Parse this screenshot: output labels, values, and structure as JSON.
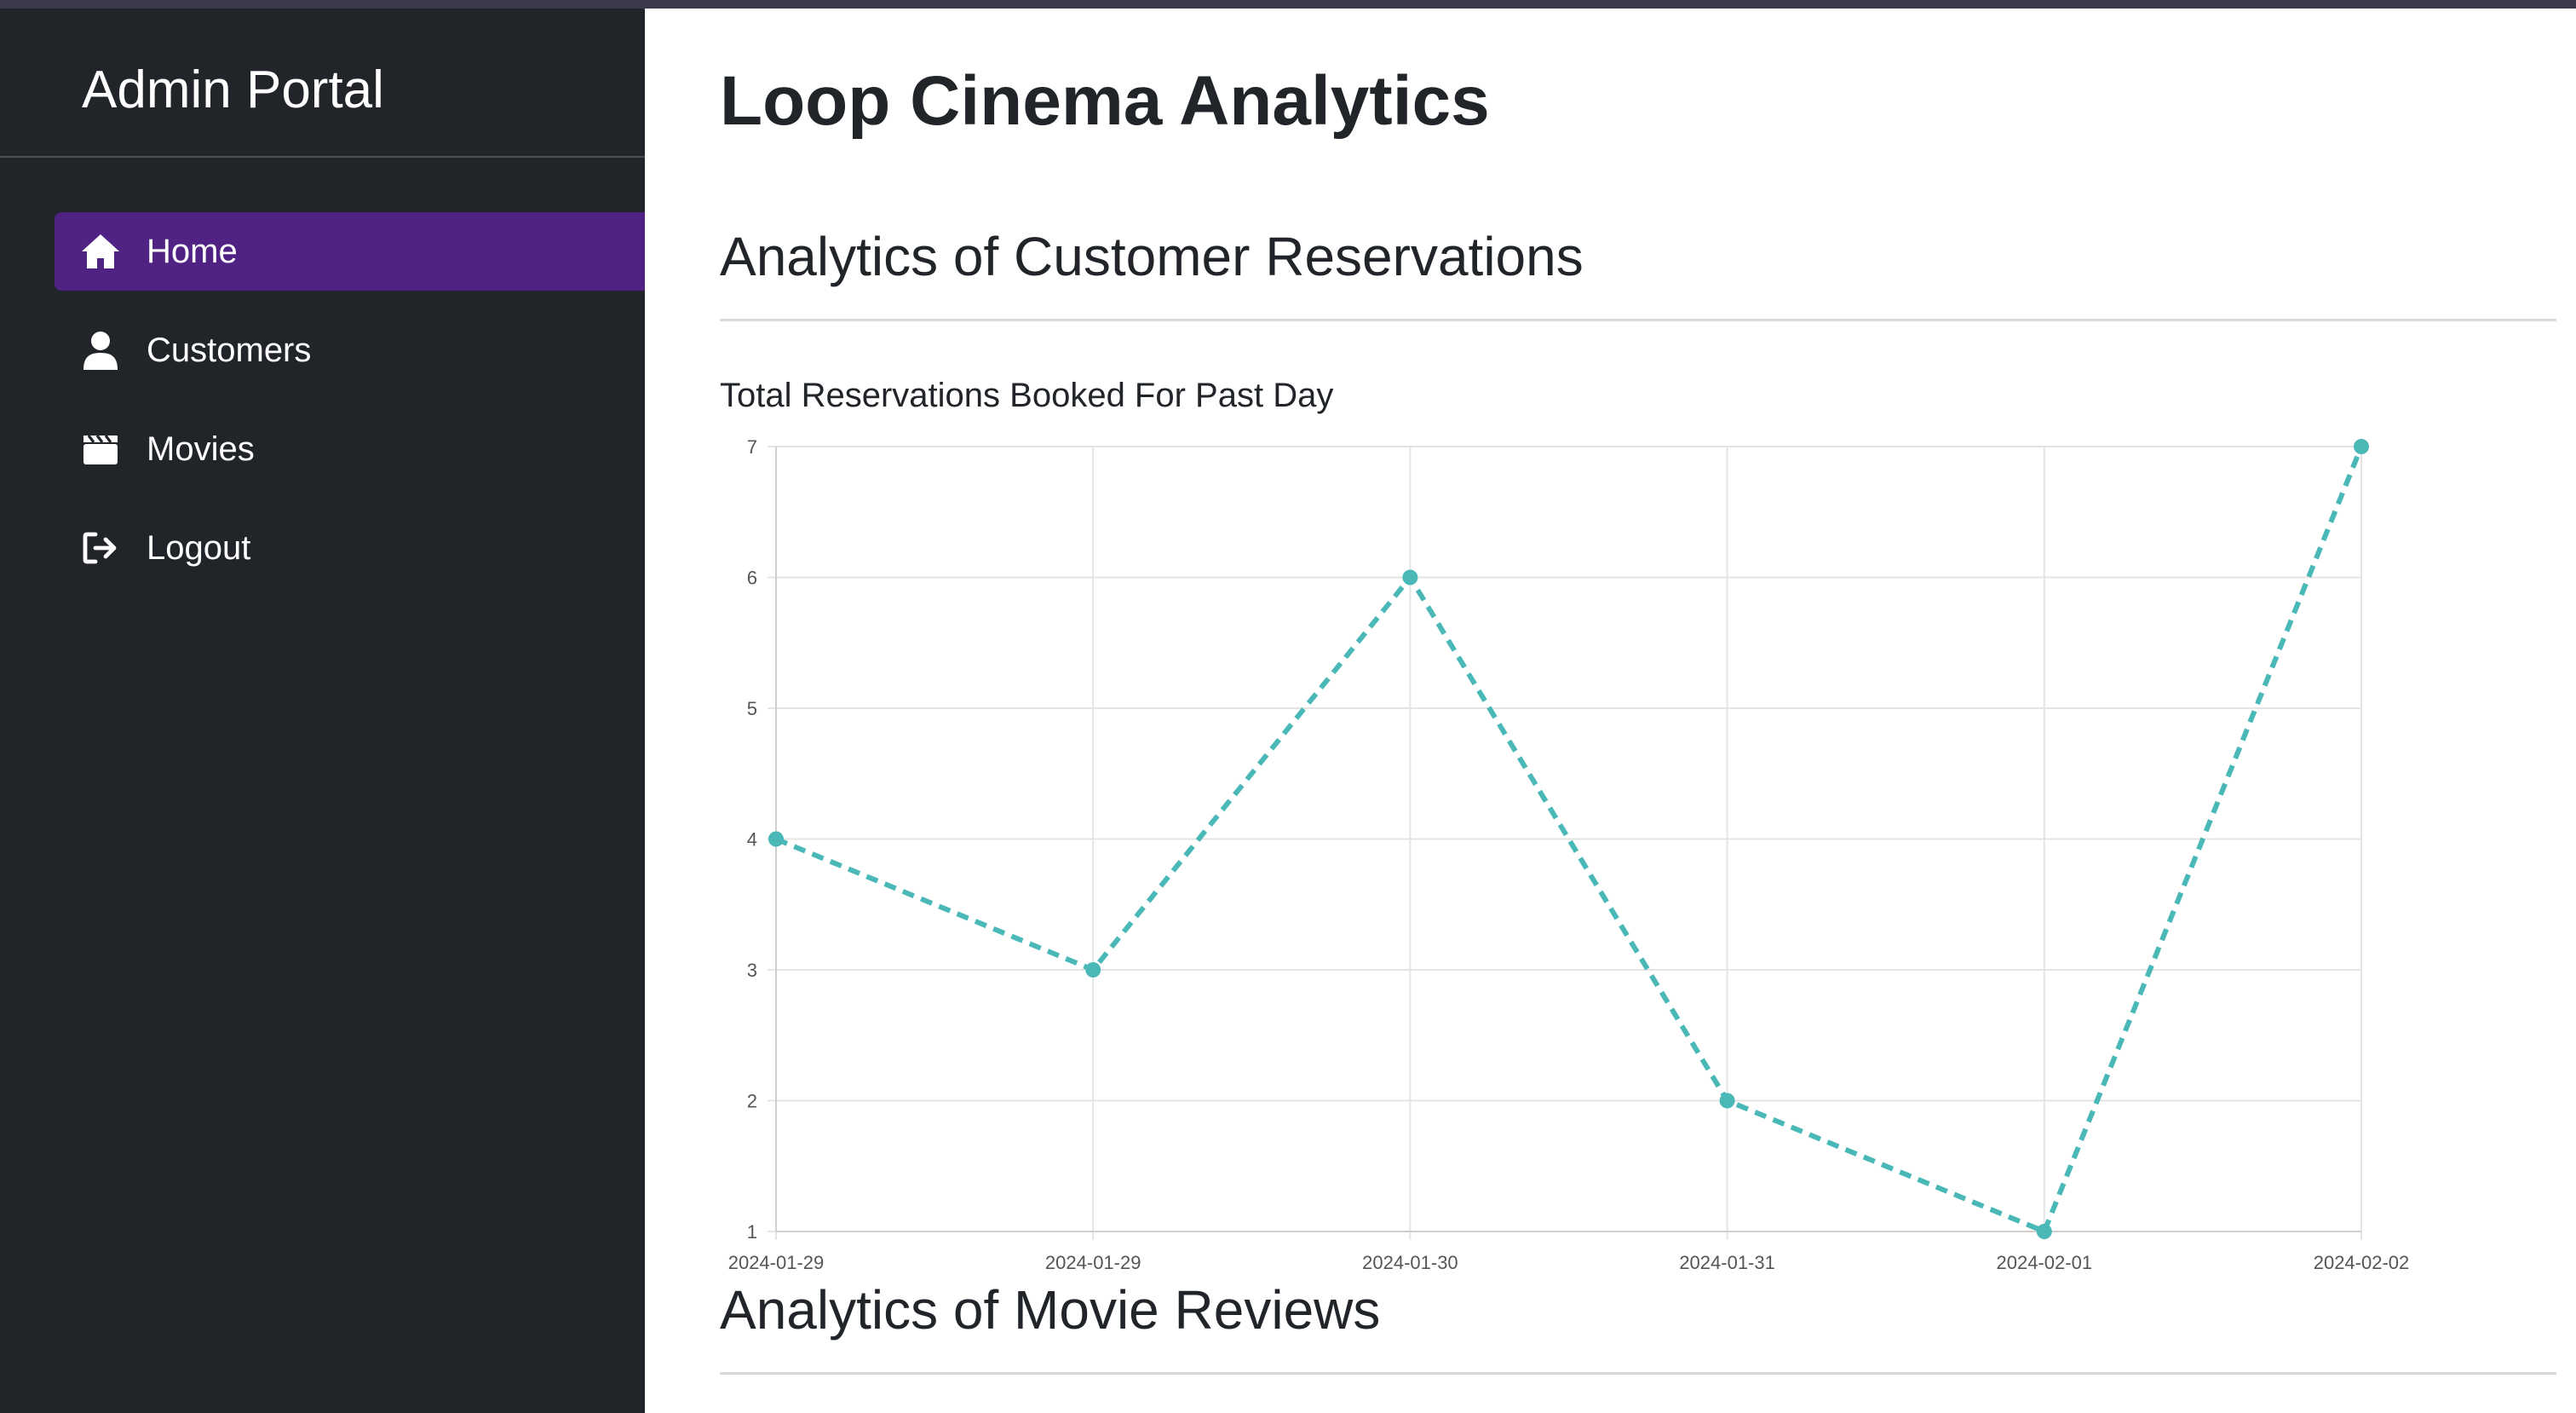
{
  "sidebar": {
    "brand": "Admin Portal",
    "items": [
      {
        "label": "Home",
        "icon": "home-icon",
        "active": true
      },
      {
        "label": "Customers",
        "icon": "user-icon",
        "active": false
      },
      {
        "label": "Movies",
        "icon": "clapperboard-icon",
        "active": false
      },
      {
        "label": "Logout",
        "icon": "logout-icon",
        "active": false
      }
    ],
    "active_color": "#4f2283",
    "background": "#212429"
  },
  "main": {
    "page_title": "Loop Cinema Analytics",
    "sections": [
      {
        "title": "Analytics of Customer Reservations"
      },
      {
        "title": "Analytics of Movie Reviews"
      }
    ]
  },
  "chart_data": {
    "type": "line",
    "title": "Total Reservations Booked For Past Day",
    "categories": [
      "2024-01-29",
      "2024-01-29",
      "2024-01-30",
      "2024-01-31",
      "2024-02-01",
      "2024-02-02"
    ],
    "series": [
      {
        "values": [
          4,
          3,
          6,
          2,
          1,
          7
        ],
        "color": "#4bb8b8",
        "style": "dashed"
      }
    ],
    "yticks": [
      1,
      2,
      3,
      4,
      5,
      6,
      7
    ],
    "ylim": [
      1,
      7
    ],
    "grid": true,
    "xlabel": "",
    "ylabel": ""
  }
}
